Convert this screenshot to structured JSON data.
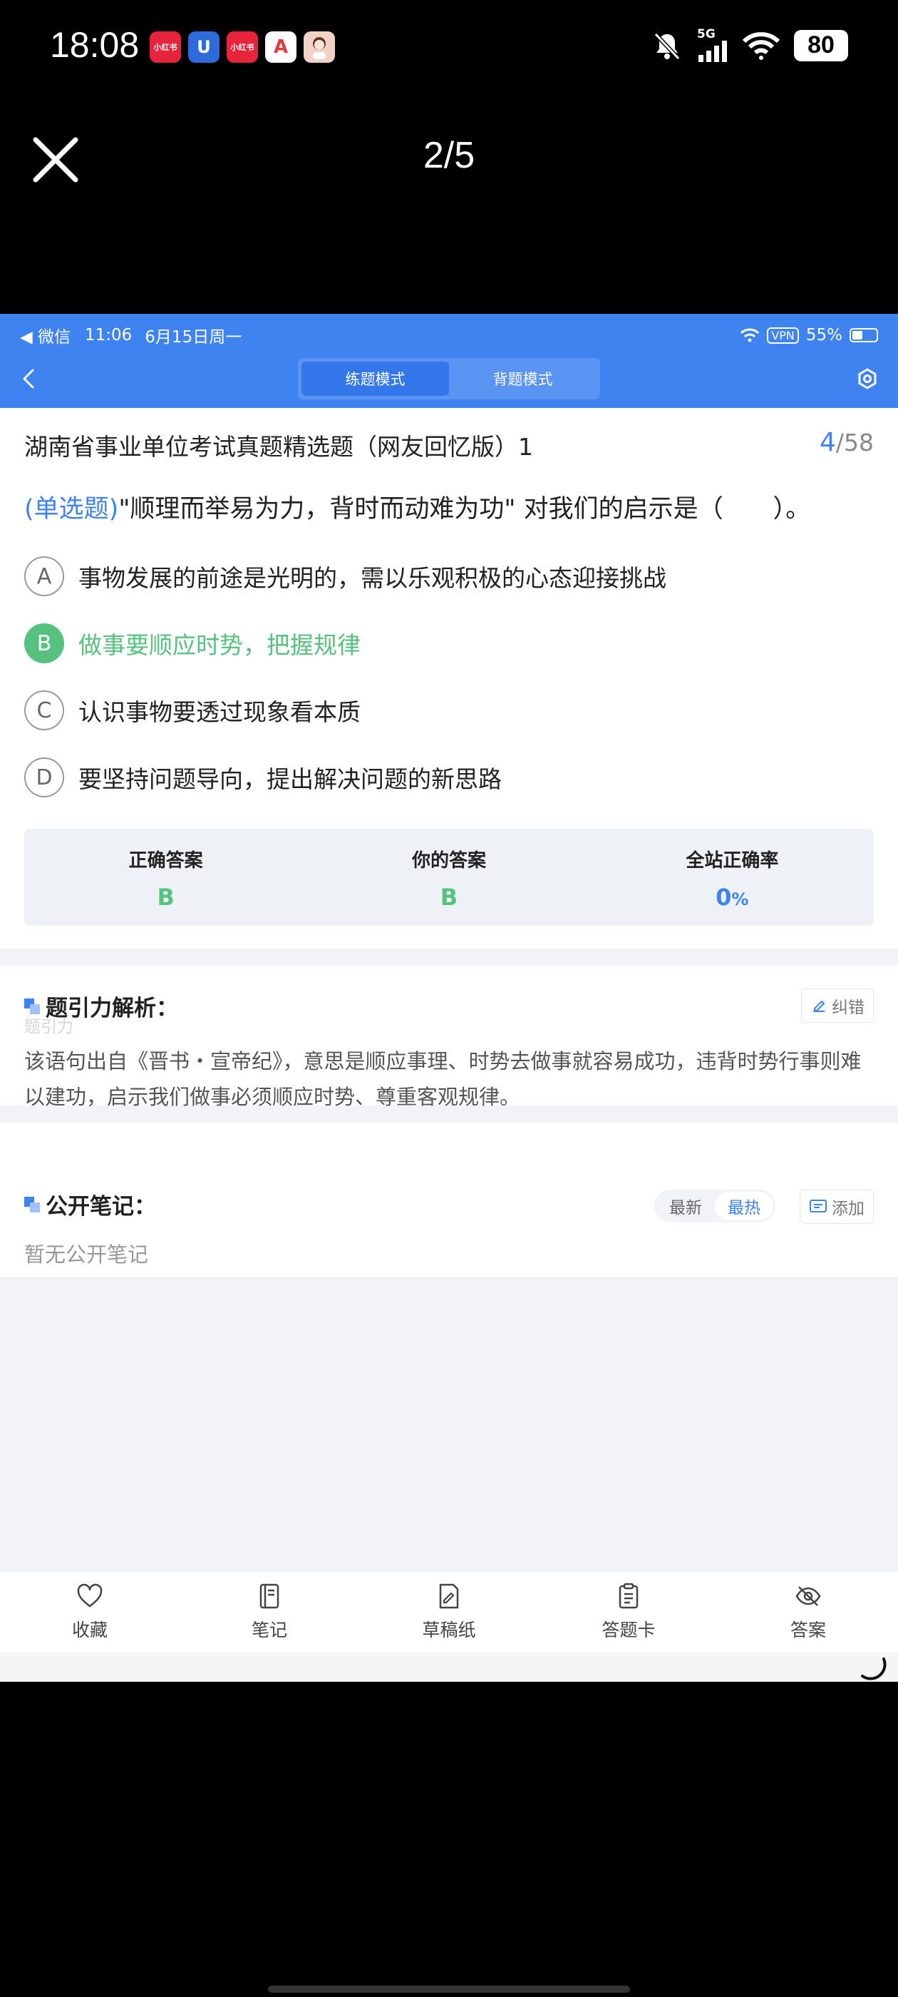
{
  "os_status": {
    "time": "18:08",
    "apps": [
      {
        "icon": "xiaohongshu-app-icon",
        "label": "小红书",
        "color": "#e8243c"
      },
      {
        "icon": "blue-app-icon",
        "label": "U",
        "color": "#2c6bd9"
      },
      {
        "icon": "xiaohongshu-app-icon",
        "label": "小红书",
        "color": "#e8243c"
      },
      {
        "icon": "a-app-icon",
        "label": "A",
        "color": "#e23b3b"
      },
      {
        "icon": "avatar-app-icon",
        "label": "",
        "color": "#f1d3c6"
      }
    ],
    "network": "5G",
    "battery": "80"
  },
  "viewer": {
    "counter": "2/5"
  },
  "inner_status": {
    "back_app": "◀ 微信",
    "time": "11:06",
    "date": "6月15日周一",
    "vpn": "VPN",
    "battery": "55%"
  },
  "header": {
    "tabs": [
      {
        "label": "练题模式",
        "active": true
      },
      {
        "label": "背题模式",
        "active": false
      }
    ]
  },
  "exam": {
    "title": "湖南省事业单位考试真题精选题（网友回忆版）1",
    "current": "4",
    "total": "/58"
  },
  "question": {
    "type": "(单选题)",
    "text": "\"顺理而举易为力，背时而动难为功\" 对我们的启示是（　　）。",
    "options": [
      {
        "letter": "A",
        "text": "事物发展的前途是光明的，需以乐观积极的心态迎接挑战",
        "correct": false
      },
      {
        "letter": "B",
        "text": "做事要顺应时势，把握规律",
        "correct": true
      },
      {
        "letter": "C",
        "text": "认识事物要透过现象看本质",
        "correct": false
      },
      {
        "letter": "D",
        "text": "要坚持问题导向，提出解决问题的新思路",
        "correct": false
      }
    ]
  },
  "stats": {
    "correct_label": "正确答案",
    "correct_value": "B",
    "yours_label": "你的答案",
    "yours_value": "B",
    "rate_label": "全站正确率",
    "rate_value": "0",
    "rate_unit": "%"
  },
  "analysis": {
    "heading": "题引力解析：",
    "watermark": "题引力",
    "report_label": "纠错",
    "text": "该语句出自《晋书・宣帝纪》，意思是顺应事理、时势去做事就容易成功，违背时势行事则难以建功，启示我们做事必须顺应时势、尊重客观规律。"
  },
  "notes": {
    "heading": "公开笔记：",
    "sort_latest": "最新",
    "sort_hot": "最热",
    "add_label": "添加",
    "empty_text": "暂无公开笔记"
  },
  "tabbar": [
    {
      "label": "收藏",
      "icon": "heart-icon"
    },
    {
      "label": "笔记",
      "icon": "notebook-icon"
    },
    {
      "label": "草稿纸",
      "icon": "draft-paper-icon"
    },
    {
      "label": "答题卡",
      "icon": "answer-card-icon"
    },
    {
      "label": "答案",
      "icon": "eye-off-icon"
    }
  ],
  "colors": {
    "accent": "#3f83f0",
    "correct": "#57c27f"
  }
}
